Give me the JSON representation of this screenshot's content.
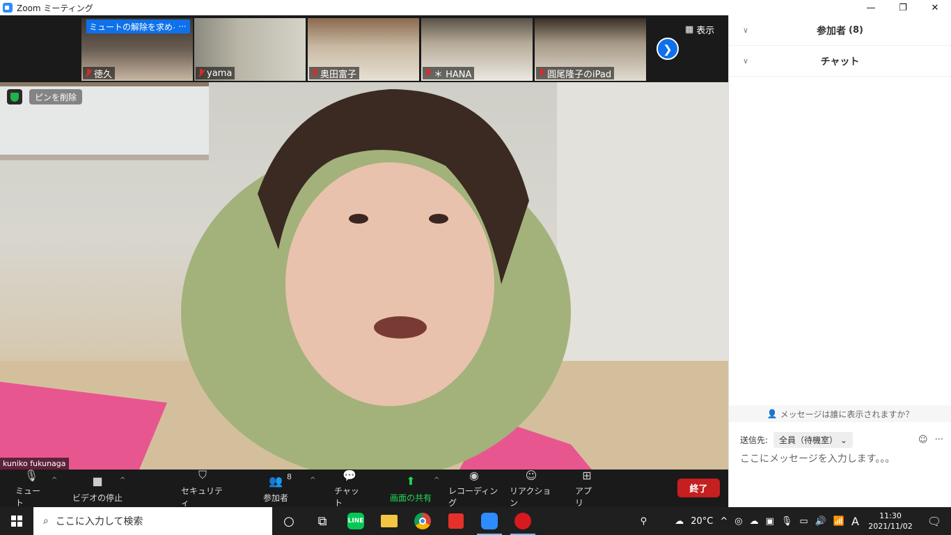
{
  "window": {
    "title": "Zoom ミーティング",
    "minimize": "—",
    "maximize": "❐",
    "close": "✕"
  },
  "thumbnails": [
    {
      "name": "徳久",
      "muted": true
    },
    {
      "name": "yama",
      "muted": true
    },
    {
      "name": "奥田富子",
      "muted": true
    },
    {
      "name": "＊ HANA",
      "muted": true
    },
    {
      "name": "圓尾隆子のiPad",
      "muted": true
    }
  ],
  "thumb_overlay": {
    "unmute_request": "ミュートの解除を求める",
    "more": "···"
  },
  "view_button": "表示",
  "main_video": {
    "unpin_label": "ピンを削除",
    "speaker_name": "kuniko fukunaga"
  },
  "controls": {
    "mute": "ミュート",
    "stop_video": "ビデオの停止",
    "security": "セキュリティ",
    "participants": "参加者",
    "participants_count": "8",
    "chat": "チャット",
    "share_screen": "画面の共有",
    "recording": "レコーディング",
    "reactions": "リアクション",
    "apps": "アプリ",
    "end": "終了"
  },
  "side_panel": {
    "participants_header": "参加者",
    "participants_count": "(8)",
    "chat_header": "チャット",
    "visibility_info": "メッセージは誰に表示されますか？",
    "send_to_label": "送信先:",
    "recipient": "全員（待機室）",
    "message_placeholder": "ここにメッセージを入力します。。。"
  },
  "taskbar": {
    "search_placeholder": "ここに入力して検索",
    "temperature": "20°C",
    "ime": "A",
    "time": "11:30",
    "date": "2021/11/02"
  },
  "colors": {
    "zoom_blue": "#0e71eb",
    "end_red": "#c51f20",
    "share_green": "#23d959",
    "mute_red": "#e02828"
  }
}
